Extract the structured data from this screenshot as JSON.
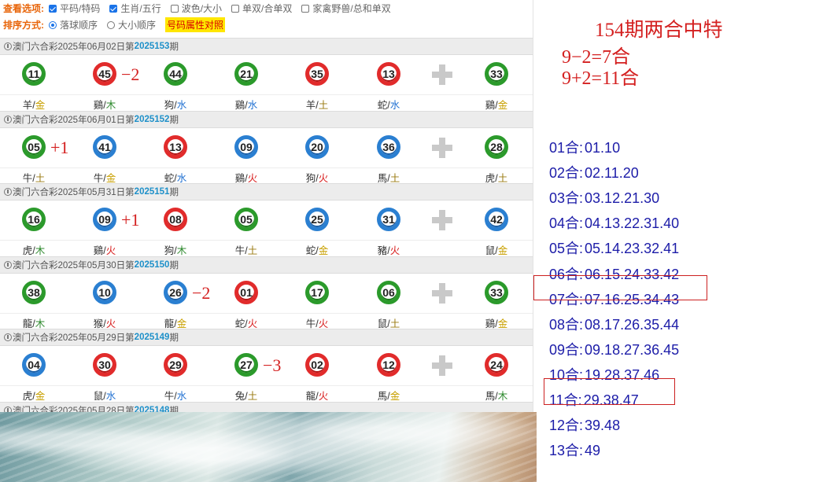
{
  "options": {
    "view_label": "查看选项:",
    "view_opts": [
      {
        "label": "平码/特码",
        "checked": true
      },
      {
        "label": "生肖/五行",
        "checked": true
      },
      {
        "label": "波色/大小",
        "checked": false
      },
      {
        "label": "单双/合单双",
        "checked": false
      },
      {
        "label": "家禽野兽/总和单双",
        "checked": false
      }
    ],
    "sort_label": "排序方式:",
    "sort_opts": [
      {
        "label": "落球顺序",
        "checked": true
      },
      {
        "label": "大小顺序",
        "checked": false
      }
    ],
    "attr_button": "号码属性对照"
  },
  "draws": [
    {
      "game": "澳门六合彩",
      "date": "2025年06月02日",
      "period_prefix": "第",
      "period": "2025153",
      "period_suffix": "期",
      "balls": [
        {
          "num": "11",
          "color": "green",
          "zodiac": "羊",
          "element": "金"
        },
        {
          "num": "45",
          "color": "red",
          "zodiac": "鷄",
          "element": "木"
        },
        {
          "num": "44",
          "color": "green",
          "zodiac": "狗",
          "element": "水"
        },
        {
          "num": "21",
          "color": "green",
          "zodiac": "鷄",
          "element": "水"
        },
        {
          "num": "35",
          "color": "red",
          "zodiac": "羊",
          "element": "土"
        },
        {
          "num": "13",
          "color": "red",
          "zodiac": "蛇",
          "element": "水"
        }
      ],
      "special": {
        "num": "33",
        "color": "green",
        "zodiac": "鷄",
        "element": "金"
      },
      "annotation": {
        "text": "−2",
        "after_ball": 1
      }
    },
    {
      "game": "澳门六合彩",
      "date": "2025年06月01日",
      "period_prefix": "第",
      "period": "2025152",
      "period_suffix": "期",
      "balls": [
        {
          "num": "05",
          "color": "green",
          "zodiac": "牛",
          "element": "土"
        },
        {
          "num": "41",
          "color": "blue",
          "zodiac": "牛",
          "element": "金"
        },
        {
          "num": "13",
          "color": "red",
          "zodiac": "蛇",
          "element": "水"
        },
        {
          "num": "09",
          "color": "blue",
          "zodiac": "鷄",
          "element": "火"
        },
        {
          "num": "20",
          "color": "blue",
          "zodiac": "狗",
          "element": "火"
        },
        {
          "num": "36",
          "color": "blue",
          "zodiac": "馬",
          "element": "土"
        }
      ],
      "special": {
        "num": "28",
        "color": "green",
        "zodiac": "虎",
        "element": "土"
      },
      "annotation": {
        "text": "+1",
        "after_ball": 0
      }
    },
    {
      "game": "澳门六合彩",
      "date": "2025年05月31日",
      "period_prefix": "第",
      "period": "2025151",
      "period_suffix": "期",
      "balls": [
        {
          "num": "16",
          "color": "green",
          "zodiac": "虎",
          "element": "木"
        },
        {
          "num": "09",
          "color": "blue",
          "zodiac": "鷄",
          "element": "火"
        },
        {
          "num": "08",
          "color": "red",
          "zodiac": "狗",
          "element": "木"
        },
        {
          "num": "05",
          "color": "green",
          "zodiac": "牛",
          "element": "土"
        },
        {
          "num": "25",
          "color": "blue",
          "zodiac": "蛇",
          "element": "金"
        },
        {
          "num": "31",
          "color": "blue",
          "zodiac": "豬",
          "element": "火"
        }
      ],
      "special": {
        "num": "42",
        "color": "blue",
        "zodiac": "鼠",
        "element": "金"
      },
      "annotation": {
        "text": "+1",
        "after_ball": 1
      }
    },
    {
      "game": "澳门六合彩",
      "date": "2025年05月30日",
      "period_prefix": "第",
      "period": "2025150",
      "period_suffix": "期",
      "balls": [
        {
          "num": "38",
          "color": "green",
          "zodiac": "龍",
          "element": "木"
        },
        {
          "num": "10",
          "color": "blue",
          "zodiac": "猴",
          "element": "火"
        },
        {
          "num": "26",
          "color": "blue",
          "zodiac": "龍",
          "element": "金"
        },
        {
          "num": "01",
          "color": "red",
          "zodiac": "蛇",
          "element": "火"
        },
        {
          "num": "17",
          "color": "green",
          "zodiac": "牛",
          "element": "火"
        },
        {
          "num": "06",
          "color": "green",
          "zodiac": "鼠",
          "element": "土"
        }
      ],
      "special": {
        "num": "33",
        "color": "green",
        "zodiac": "鷄",
        "element": "金"
      },
      "annotation": {
        "text": "−2",
        "after_ball": 2
      }
    },
    {
      "game": "澳门六合彩",
      "date": "2025年05月29日",
      "period_prefix": "第",
      "period": "2025149",
      "period_suffix": "期",
      "balls": [
        {
          "num": "04",
          "color": "blue",
          "zodiac": "虎",
          "element": "金"
        },
        {
          "num": "30",
          "color": "red",
          "zodiac": "鼠",
          "element": "水"
        },
        {
          "num": "29",
          "color": "red",
          "zodiac": "牛",
          "element": "水"
        },
        {
          "num": "27",
          "color": "green",
          "zodiac": "兔",
          "element": "土"
        },
        {
          "num": "02",
          "color": "red",
          "zodiac": "龍",
          "element": "火"
        },
        {
          "num": "12",
          "color": "red",
          "zodiac": "馬",
          "element": "金"
        }
      ],
      "special": {
        "num": "24",
        "color": "red",
        "zodiac": "馬",
        "element": "木"
      },
      "annotation": {
        "text": "−3",
        "after_ball": 3
      }
    },
    {
      "game": "澳门六合彩",
      "date": "2025年05月28日",
      "period_prefix": "第",
      "period": "2025148",
      "period_suffix": "期",
      "balls": [],
      "special": null,
      "annotation": null
    }
  ],
  "right": {
    "title": "154期两合中特",
    "formulas": [
      "9−2=7合",
      "9+2=11合"
    ],
    "combos": [
      {
        "k": "01合:",
        "v": "01.10",
        "boxed": false
      },
      {
        "k": "02合:",
        "v": "02.11.20",
        "boxed": false
      },
      {
        "k": "03合:",
        "v": "03.12.21.30",
        "boxed": false
      },
      {
        "k": "04合:",
        "v": "04.13.22.31.40",
        "boxed": false
      },
      {
        "k": "05合:",
        "v": "05.14.23.32.41",
        "boxed": false
      },
      {
        "k": "06合:",
        "v": "06.15.24.33.42",
        "boxed": false
      },
      {
        "k": "07合:",
        "v": "07.16.25.34.43",
        "boxed": true
      },
      {
        "k": "08合:",
        "v": "08.17.26.35.44",
        "boxed": false
      },
      {
        "k": "09合:",
        "v": "09.18.27.36.45",
        "boxed": false
      },
      {
        "k": "10合:",
        "v": "19.28.37.46",
        "boxed": false
      },
      {
        "k": "11合:",
        "v": "29.38.47",
        "boxed": true
      },
      {
        "k": "12合:",
        "v": "39.48",
        "boxed": false
      },
      {
        "k": "13合:",
        "v": "49",
        "boxed": false
      }
    ]
  }
}
